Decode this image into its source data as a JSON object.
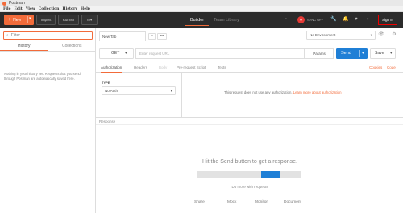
{
  "titlebar": {
    "title": "Postman"
  },
  "menu": [
    "File",
    "Edit",
    "View",
    "Collection",
    "History",
    "Help"
  ],
  "topbar": {
    "new_label": "New",
    "import_label": "Import",
    "runner_label": "Runner",
    "tabs": [
      "Builder",
      "Team Library"
    ],
    "user_name": "SYNC OFF",
    "sign_in_label": "Sign In"
  },
  "sidebar": {
    "filter_placeholder": "Filter",
    "tabs": [
      "History",
      "Collections"
    ],
    "empty_message": "Nothing in your history yet. Requests that you send through Postman are automatically saved here."
  },
  "request_tab": {
    "label": "New Tab"
  },
  "environment": {
    "selected": "No Environment"
  },
  "request": {
    "method": "GET",
    "url_placeholder": "Enter request URL",
    "params_label": "Params",
    "send_label": "Send",
    "save_label": "Save"
  },
  "subtabs": [
    "Authorization",
    "Headers",
    "Body",
    "Pre-request Script",
    "Tests"
  ],
  "subtab_links": {
    "cookies": "Cookies",
    "code": "Code"
  },
  "auth": {
    "type_label": "TYPE",
    "type_value": "No Auth",
    "message": "This request does not use any authorization.",
    "link": "Learn more about authorization"
  },
  "response": {
    "label": "Response",
    "hint": "Hit the Send button to get a response.",
    "do_more": "Do more with requests",
    "links": [
      "Share",
      "Mock",
      "Monitor",
      "Document"
    ]
  },
  "colors": {
    "accent": "#f26b3a",
    "send_blue": "#1f7fd6",
    "topbar_bg": "#2b2b2b"
  }
}
